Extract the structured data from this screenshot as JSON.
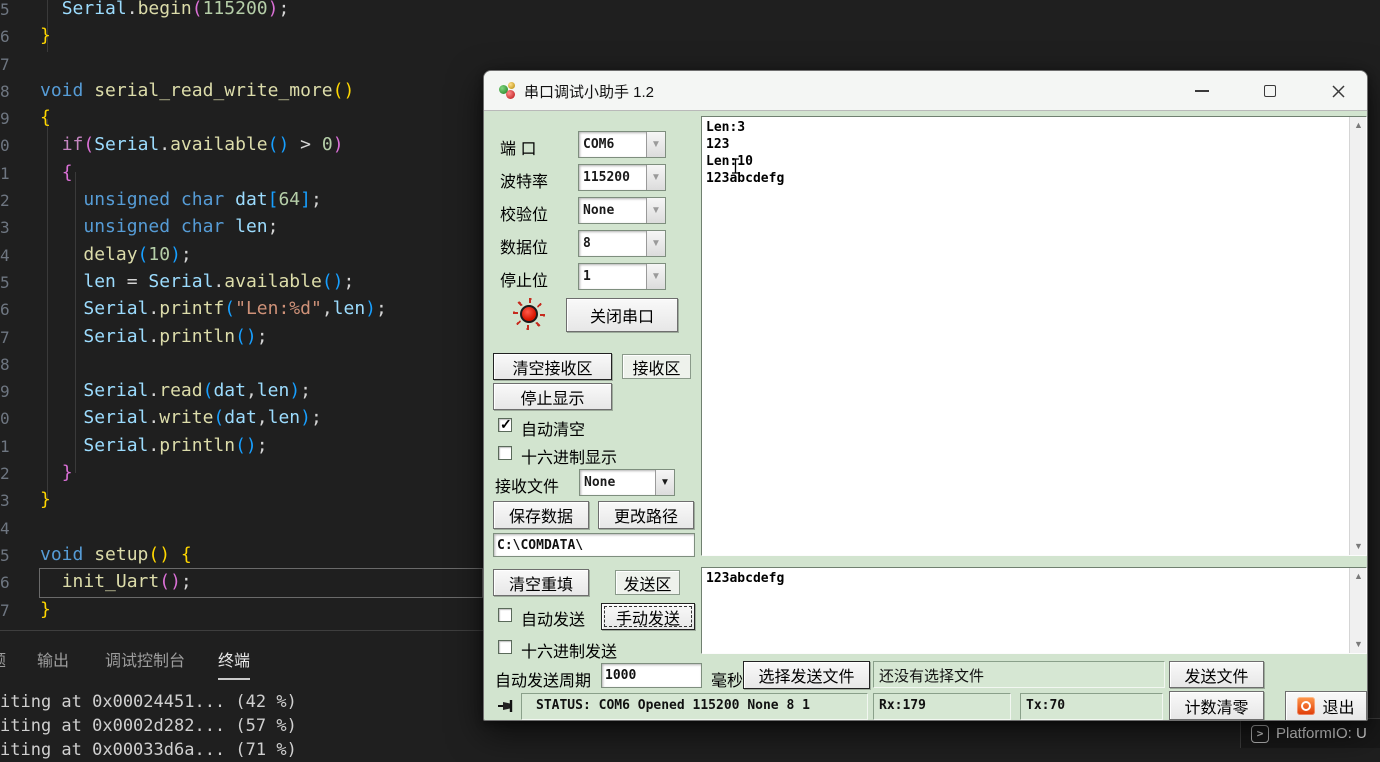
{
  "editor": {
    "lines": [
      {
        "n": "5",
        "t": [
          [
            "  ",
            "p"
          ],
          [
            "Serial",
            "var"
          ],
          [
            ".",
            "p"
          ],
          [
            "begin",
            "fn"
          ],
          [
            "(",
            "b2"
          ],
          [
            "115200",
            "num"
          ],
          [
            ")",
            "b2"
          ],
          [
            ";",
            "p"
          ]
        ]
      },
      {
        "n": "6",
        "t": [
          [
            "}",
            "b1"
          ]
        ]
      },
      {
        "n": "7",
        "t": []
      },
      {
        "n": "8",
        "t": [
          [
            "void",
            "kw"
          ],
          [
            " ",
            "p"
          ],
          [
            "serial_read_write_more",
            "fn"
          ],
          [
            "()",
            "b1"
          ]
        ]
      },
      {
        "n": "9",
        "t": [
          [
            "{",
            "b1"
          ]
        ]
      },
      {
        "n": "0",
        "t": [
          [
            "  ",
            "p"
          ],
          [
            "if",
            "ctrl"
          ],
          [
            "(",
            "b2"
          ],
          [
            "Serial",
            "var"
          ],
          [
            ".",
            "p"
          ],
          [
            "available",
            "fn"
          ],
          [
            "()",
            "b3"
          ],
          [
            " > ",
            "p"
          ],
          [
            "0",
            "num"
          ],
          [
            ")",
            "b2"
          ]
        ]
      },
      {
        "n": "1",
        "t": [
          [
            "  ",
            "p"
          ],
          [
            "{",
            "b2"
          ]
        ]
      },
      {
        "n": "2",
        "t": [
          [
            "    ",
            "p"
          ],
          [
            "unsigned",
            "kw"
          ],
          [
            " ",
            "p"
          ],
          [
            "char",
            "kw"
          ],
          [
            " ",
            "p"
          ],
          [
            "dat",
            "var"
          ],
          [
            "[",
            "b3"
          ],
          [
            "64",
            "num"
          ],
          [
            "]",
            "b3"
          ],
          [
            ";",
            "p"
          ]
        ]
      },
      {
        "n": "3",
        "t": [
          [
            "    ",
            "p"
          ],
          [
            "unsigned",
            "kw"
          ],
          [
            " ",
            "p"
          ],
          [
            "char",
            "kw"
          ],
          [
            " ",
            "p"
          ],
          [
            "len",
            "var"
          ],
          [
            ";",
            "p"
          ]
        ]
      },
      {
        "n": "4",
        "t": [
          [
            "    ",
            "p"
          ],
          [
            "delay",
            "fn"
          ],
          [
            "(",
            "b3"
          ],
          [
            "10",
            "num"
          ],
          [
            ")",
            "b3"
          ],
          [
            ";",
            "p"
          ]
        ]
      },
      {
        "n": "5",
        "t": [
          [
            "    ",
            "p"
          ],
          [
            "len",
            "var"
          ],
          [
            " = ",
            "p"
          ],
          [
            "Serial",
            "var"
          ],
          [
            ".",
            "p"
          ],
          [
            "available",
            "fn"
          ],
          [
            "()",
            "b3"
          ],
          [
            ";",
            "p"
          ]
        ]
      },
      {
        "n": "6",
        "t": [
          [
            "    ",
            "p"
          ],
          [
            "Serial",
            "var"
          ],
          [
            ".",
            "p"
          ],
          [
            "printf",
            "fn"
          ],
          [
            "(",
            "b3"
          ],
          [
            "\"Len:%d\"",
            "str"
          ],
          [
            ",",
            "p"
          ],
          [
            "len",
            "var"
          ],
          [
            ")",
            "b3"
          ],
          [
            ";",
            "p"
          ]
        ]
      },
      {
        "n": "7",
        "t": [
          [
            "    ",
            "p"
          ],
          [
            "Serial",
            "var"
          ],
          [
            ".",
            "p"
          ],
          [
            "println",
            "fn"
          ],
          [
            "()",
            "b3"
          ],
          [
            ";",
            "p"
          ]
        ]
      },
      {
        "n": "8",
        "t": []
      },
      {
        "n": "9",
        "t": [
          [
            "    ",
            "p"
          ],
          [
            "Serial",
            "var"
          ],
          [
            ".",
            "p"
          ],
          [
            "read",
            "fn"
          ],
          [
            "(",
            "b3"
          ],
          [
            "dat",
            "var"
          ],
          [
            ",",
            "p"
          ],
          [
            "len",
            "var"
          ],
          [
            ")",
            "b3"
          ],
          [
            ";",
            "p"
          ]
        ]
      },
      {
        "n": "0",
        "t": [
          [
            "    ",
            "p"
          ],
          [
            "Serial",
            "var"
          ],
          [
            ".",
            "p"
          ],
          [
            "write",
            "fn"
          ],
          [
            "(",
            "b3"
          ],
          [
            "dat",
            "var"
          ],
          [
            ",",
            "p"
          ],
          [
            "len",
            "var"
          ],
          [
            ")",
            "b3"
          ],
          [
            ";",
            "p"
          ]
        ]
      },
      {
        "n": "1",
        "t": [
          [
            "    ",
            "p"
          ],
          [
            "Serial",
            "var"
          ],
          [
            ".",
            "p"
          ],
          [
            "println",
            "fn"
          ],
          [
            "()",
            "b3"
          ],
          [
            ";",
            "p"
          ]
        ]
      },
      {
        "n": "2",
        "t": [
          [
            "  ",
            "p"
          ],
          [
            "}",
            "b2"
          ]
        ]
      },
      {
        "n": "3",
        "t": [
          [
            "}",
            "b1"
          ]
        ]
      },
      {
        "n": "4",
        "t": []
      },
      {
        "n": "5",
        "t": [
          [
            "void",
            "kw"
          ],
          [
            " ",
            "p"
          ],
          [
            "setup",
            "fn"
          ],
          [
            "()",
            "b1"
          ],
          [
            " ",
            "p"
          ],
          [
            "{",
            "b1"
          ]
        ]
      },
      {
        "n": "6",
        "t": [
          [
            "  ",
            "p"
          ],
          [
            "init_Uart",
            "fn"
          ],
          [
            "()",
            "b2"
          ],
          [
            ";",
            "p"
          ]
        ]
      },
      {
        "n": "7",
        "t": [
          [
            "}",
            "b1"
          ]
        ]
      }
    ]
  },
  "panel": {
    "tabs": [
      {
        "label": "题",
        "active": false
      },
      {
        "label": "输出",
        "active": false
      },
      {
        "label": "调试控制台",
        "active": false
      },
      {
        "label": "终端",
        "active": true
      }
    ],
    "terminal_lines": [
      "iting at 0x00024451... (42 %)",
      "iting at 0x0002d282... (57 %)",
      "iting at 0x00033d6a... (71 %)"
    ]
  },
  "statusbar": {
    "platformio": "PlatformIO: U",
    "pio_icon_glyph": ">"
  },
  "serial": {
    "title": "串口调试小助手 1.2",
    "settings": [
      {
        "label": "端  口",
        "value": "COM6",
        "enabled": false
      },
      {
        "label": "波特率",
        "value": "115200",
        "enabled": false
      },
      {
        "label": "校验位",
        "value": "None",
        "enabled": false
      },
      {
        "label": "数据位",
        "value": "8",
        "enabled": false
      },
      {
        "label": "停止位",
        "value": "1",
        "enabled": false
      }
    ],
    "close_port_btn": "关闭串口",
    "receive": {
      "clear_btn": "清空接收区",
      "zone_label": "接收区",
      "stop_btn": "停止显示",
      "auto_clear": {
        "label": "自动清空",
        "checked": true
      },
      "hex_display": {
        "label": "十六进制显示",
        "checked": false
      },
      "file_label": "接收文件",
      "file_value": "None",
      "save_btn": "保存数据",
      "path_btn": "更改路径",
      "path": "C:\\COMDATA\\",
      "content": "Len:3\n123\nLen:10\n123abcdefg"
    },
    "send": {
      "clear_btn": "清空重填",
      "zone_label": "发送区",
      "auto_send": {
        "label": "自动发送",
        "checked": false
      },
      "manual_btn": "手动发送",
      "hex_send": {
        "label": "十六进制发送",
        "checked": false
      },
      "period_label": "自动发送周期",
      "period_value": "1000",
      "period_unit": "毫秒",
      "choose_file_btn": "选择发送文件",
      "file_status": "还没有选择文件",
      "send_file_btn": "发送文件",
      "content": "123abcdefg"
    },
    "status_row": {
      "status": "STATUS: COM6 Opened 115200 None 8 1",
      "rx": "Rx:179",
      "tx": "Tx:70",
      "reset_btn": "计数清零",
      "exit_btn": "退出"
    },
    "scroll_up_glyph": "▲",
    "scroll_down_glyph": "▼",
    "combo_arrow_glyph": "▼"
  }
}
